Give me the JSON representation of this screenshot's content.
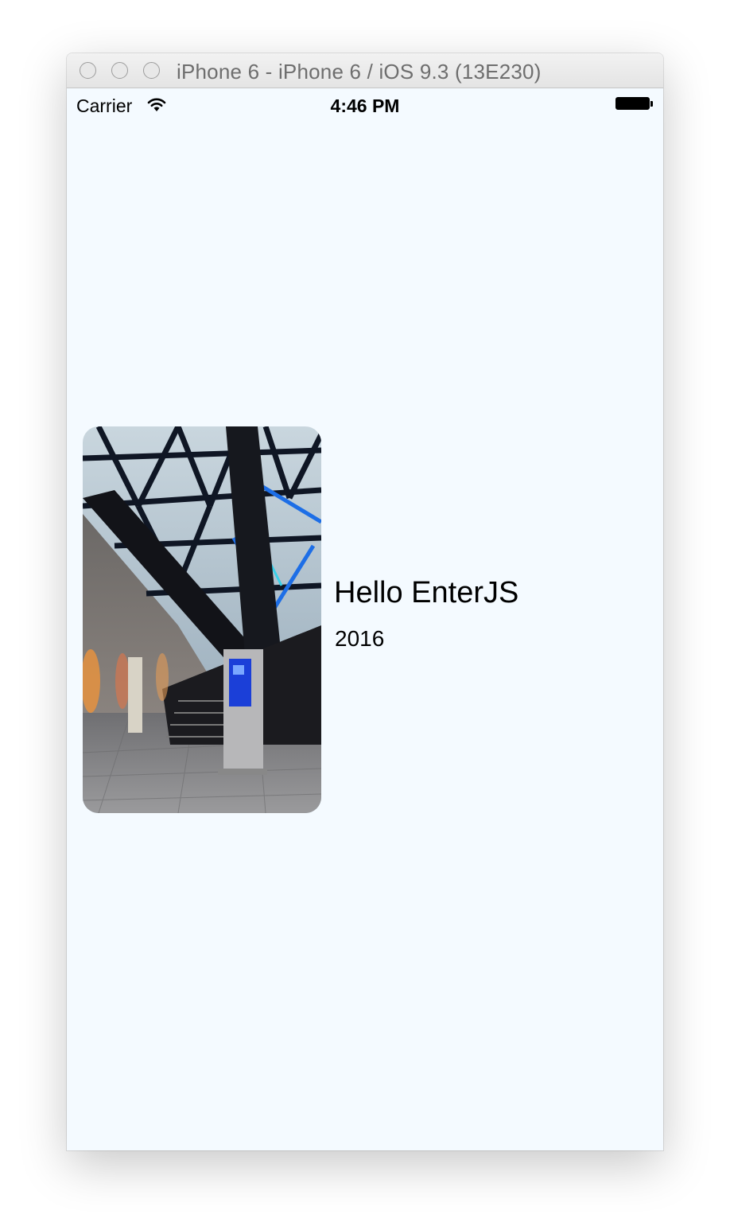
{
  "window": {
    "title": "iPhone 6 - iPhone 6 / iOS 9.3 (13E230)",
    "traffic_lights": [
      "close-button",
      "minimize-button",
      "zoom-button"
    ]
  },
  "status_bar": {
    "carrier": "Carrier",
    "time": "4:46 PM",
    "wifi_icon": "wifi-icon",
    "battery_icon": "battery-icon",
    "battery_level": 1.0
  },
  "content": {
    "image_description_icon": "photo-image",
    "title": "Hello EnterJS",
    "subtitle": "2016"
  },
  "colors": {
    "screen_background": "#f4faff",
    "text": "#000000",
    "titlebar_text": "#6e6e6e"
  }
}
